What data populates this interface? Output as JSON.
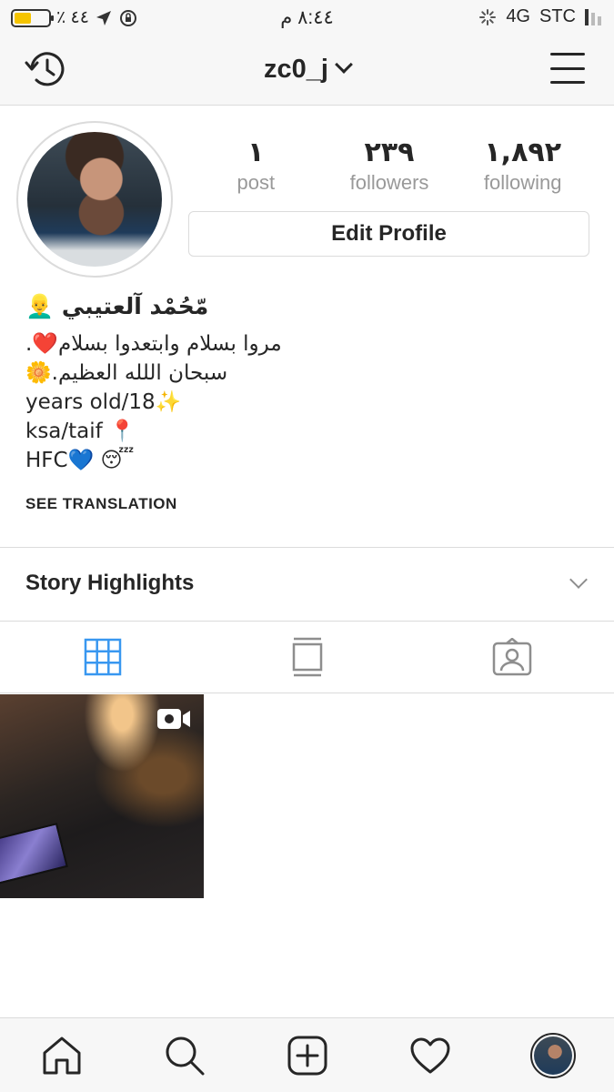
{
  "status_bar": {
    "battery_percent_text": "٪ ٤٤",
    "battery_level": 0.44,
    "time": "٨:٤٤ م",
    "network": "4G",
    "carrier": "STC"
  },
  "nav": {
    "username": "zc0_j"
  },
  "profile": {
    "stats": [
      {
        "value": "١",
        "label": "post"
      },
      {
        "value": "٢٣٩",
        "label": "followers"
      },
      {
        "value": "١,٨٩٢",
        "label": "following"
      }
    ],
    "edit_button": "Edit Profile",
    "display_name": "مّحُمْد آلعتيبي 👱‍♂️",
    "bio_lines": [
      "مروا بسلام وابتعدوا بسلام❤️.",
      "سبحان اللله العظيم.🌼",
      "years old/18✨",
      "ksa/taif 📍",
      "HFC💙 😴"
    ],
    "see_translation": "SEE TRANSLATION"
  },
  "highlights": {
    "title": "Story Highlights"
  },
  "tabs": [
    {
      "name": "grid-icon",
      "active": true
    },
    {
      "name": "feed-icon",
      "active": false
    },
    {
      "name": "tagged-icon",
      "active": false
    }
  ],
  "colors": {
    "active_tab": "#3897f0",
    "inactive_icon": "#8e8e8e",
    "text": "#262626",
    "secondary_text": "#999999"
  }
}
